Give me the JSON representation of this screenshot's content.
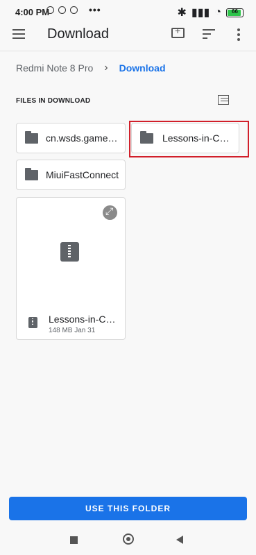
{
  "status": {
    "time": "4:00 PM",
    "dots": "•••",
    "battery": "66"
  },
  "app_bar": {
    "title": "Download"
  },
  "breadcrumb": {
    "device": "Redmi Note 8 Pro",
    "separator": "›",
    "current": "Download"
  },
  "section": {
    "header": "FILES IN DOWNLOAD"
  },
  "folders": [
    {
      "label": "cn.wsds.game...."
    },
    {
      "label": "Lessons-in-Che..."
    },
    {
      "label": "MiuiFastConnect"
    }
  ],
  "file_card": {
    "name": "Lessons-in-Che...",
    "meta": "148 MB Jan 31"
  },
  "actions": {
    "use_folder": "USE THIS FOLDER"
  },
  "colors": {
    "accent": "#1a73e8",
    "highlight": "#d11f2a",
    "icon": "#5f6368"
  },
  "icons": [
    "menu-icon",
    "new-folder-icon",
    "sort-icon",
    "more-icon",
    "folder-icon",
    "list-view-icon",
    "expand-icon",
    "zip-icon"
  ]
}
